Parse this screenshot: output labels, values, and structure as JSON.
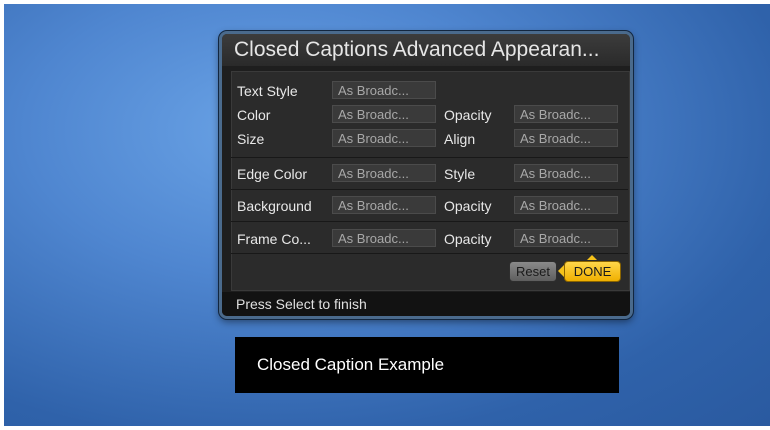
{
  "dialog": {
    "title": "Closed Captions Advanced Appearan...",
    "status": "Press Select to finish",
    "rows": {
      "text_style": {
        "label": "Text Style",
        "value": "As Broadc..."
      },
      "color": {
        "label": "Color",
        "value": "As Broadc..."
      },
      "color_opacity": {
        "label": "Opacity",
        "value": "As Broadc..."
      },
      "size": {
        "label": "Size",
        "value": "As Broadc..."
      },
      "align": {
        "label": "Align",
        "value": "As Broadc..."
      },
      "edge_color": {
        "label": "Edge Color",
        "value": "As Broadc..."
      },
      "edge_style": {
        "label": "Style",
        "value": "As Broadc..."
      },
      "background": {
        "label": "Background",
        "value": "As Broadc..."
      },
      "background_opacity": {
        "label": "Opacity",
        "value": "As Broadc..."
      },
      "frame_color": {
        "label": "Frame Co...",
        "value": "As Broadc..."
      },
      "frame_opacity": {
        "label": "Opacity",
        "value": "As Broadc..."
      }
    },
    "buttons": {
      "reset": "Reset",
      "done": "DONE"
    }
  },
  "example": {
    "text": "Closed Caption Example"
  },
  "colors": {
    "background": "#4f86d0",
    "dialog_bg": "#1e1e1e",
    "done_button": "#f5c21a",
    "reset_button": "#7a7a7a"
  }
}
